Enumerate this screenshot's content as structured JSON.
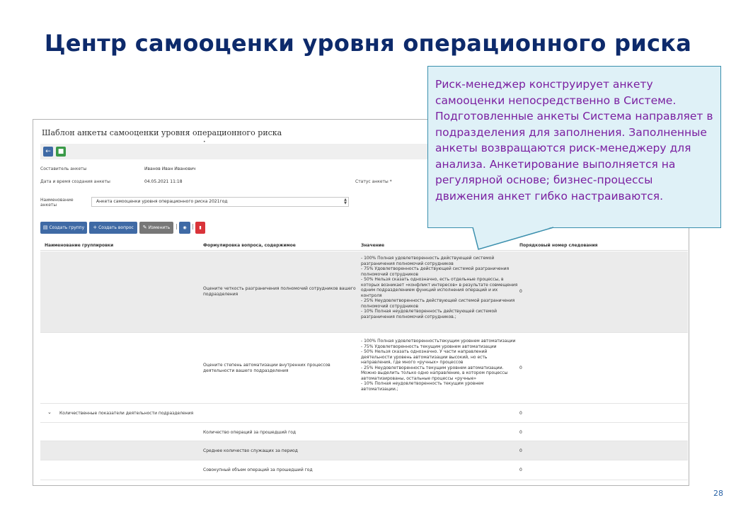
{
  "slide": {
    "title": "Центр самооценки уровня операционного риска",
    "page_number": "28"
  },
  "callout": {
    "text": "Риск-менеджер конструирует анкету самооценки непосредственно в Системе. Подготовленные анкеты Система направляет в подразделения для заполнения. Заполненные анкеты возвращаются риск-менеджеру для анализа. Анкетирование выполняется на регулярной основе; бизнес-процессы движения анкет гибко настраиваются."
  },
  "form": {
    "title": "Шаблон анкеты самооценки уровня операционного риска",
    "title_dot": "•",
    "icons": {
      "back": "arrow-left-icon",
      "save": "save-icon"
    },
    "author_label": "Составитель анкеты",
    "author_value": "Иванов Иван Иванович",
    "created_label": "Дата и время создания анкеты",
    "created_value": "04.05.2021 11:18",
    "status_label": "Статус анкеты *",
    "name_label_1": "Наименование",
    "name_label_2": "анкеты",
    "name_value": "Анкета самооценки уровня операционного риска 2021год"
  },
  "actions": {
    "create_group": "Создать группу",
    "create_question": "Создать вопрос",
    "edit": "Изменить",
    "separator": "|",
    "colors": {
      "blue": "#3f6aa5",
      "gray": "#777777",
      "red": "#d9343a",
      "green": "#3a9a48"
    }
  },
  "table": {
    "headers": {
      "group": "Наименование группировки",
      "question": "Формулировка вопроса, содержимое",
      "value": "Значение",
      "order": "Порядковый номер следования"
    },
    "rows": [
      {
        "group": "",
        "question": [
          "Оцените четкость разграничения полномочий сотрудников вашего",
          "подразделения"
        ],
        "values": [
          "- 100% Полная удовлетворенность действующей системой",
          "разграничения полномочий сотрудников",
          "- 75% Удовлетворенность действующей системой разграничения",
          "полномочий сотрудников",
          "- 50% Нельзя сказать однозначно, есть отдельные процессы, в",
          "которых возникает «конфликт интересов» в результате совмещения",
          "одним подразделением функций исполнения операций и их",
          "контроля",
          "- 25% Неудовлетворенность действующей системой разграничения",
          "полномочий сотрудников",
          "- 10% Полная неудовлетворенность действующей системой",
          "разграничения полномочий сотрудников.;"
        ],
        "order": "0"
      },
      {
        "group": "",
        "question": [
          "Оцените степень автоматизации внутренних процессов",
          "деятельности вашего подразделения"
        ],
        "values": [
          "- 100% Полная удовлетворенностьтекущим уровнем автоматизации",
          "- 75% Удовлетворенность текущим уровнем автоматизации",
          "- 50% Нельзя сказать однозначно. У части направлений",
          "деятельности уровень автоматизации высокий, но есть",
          "направления, где много «ручных» процессов",
          "- 25% Неудовлетворенность текущим уровнем автоматизации.",
          "Можно выделить только одно направление, в котором процессы",
          "автоматизированы, остальные процессы «ручные»",
          "- 10% Полная неудовлетворенность текущим уровнем",
          "автоматизации.;"
        ],
        "order": "0"
      },
      {
        "group": "Количественные показатели деятельности подразделения",
        "question": [],
        "values": [],
        "order": "0"
      },
      {
        "group": "",
        "question": [
          "Количество операций за прошедший год"
        ],
        "values": [],
        "order": "0"
      },
      {
        "group": "",
        "question": [
          "Среднее количество служащих за период"
        ],
        "values": [],
        "order": "0"
      },
      {
        "group": "",
        "question": [
          "Совокупный объем операций за прошедший год"
        ],
        "values": [],
        "order": "0"
      }
    ],
    "collapse_icon": "chevron-down-icon"
  }
}
